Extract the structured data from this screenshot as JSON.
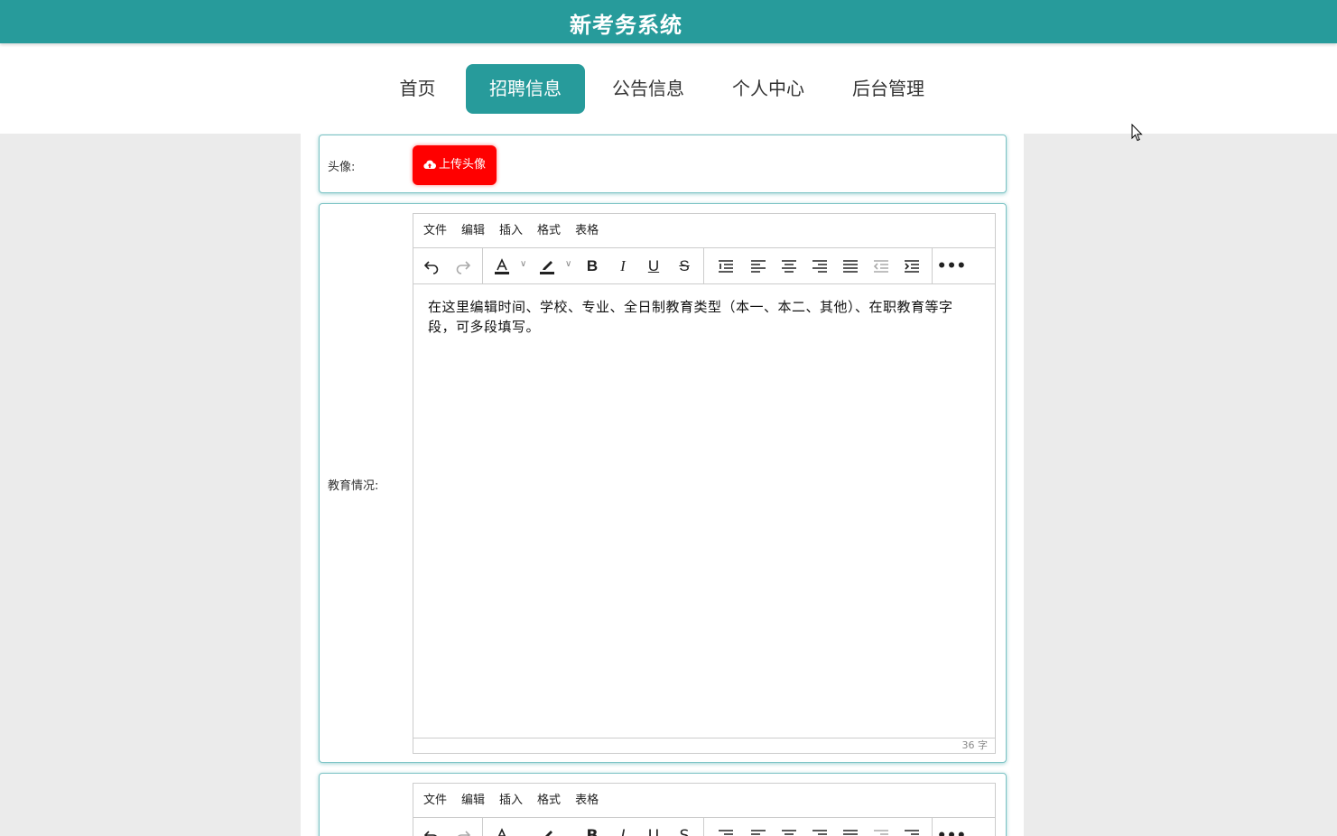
{
  "header": {
    "title": "新考务系统"
  },
  "nav": {
    "items": [
      {
        "label": "首页"
      },
      {
        "label": "招聘信息"
      },
      {
        "label": "公告信息"
      },
      {
        "label": "个人中心"
      },
      {
        "label": "后台管理"
      }
    ]
  },
  "form": {
    "avatar": {
      "label": "头像:",
      "upload_label": "上传头像"
    },
    "education": {
      "label": "教育情况:",
      "menu": [
        "文件",
        "编辑",
        "插入",
        "格式",
        "表格"
      ],
      "content": "在这里编辑时间、学校、专业、全日制教育类型（本一、本二、其他）、在职教育等字段，可多段填写。",
      "word_count": "36 字"
    },
    "next_editor": {
      "menu": [
        "文件",
        "编辑",
        "插入",
        "格式",
        "表格"
      ]
    }
  },
  "colors": {
    "primary": "#279b9b",
    "upload_button": "#ff0000",
    "page_background": "#ebebeb"
  }
}
